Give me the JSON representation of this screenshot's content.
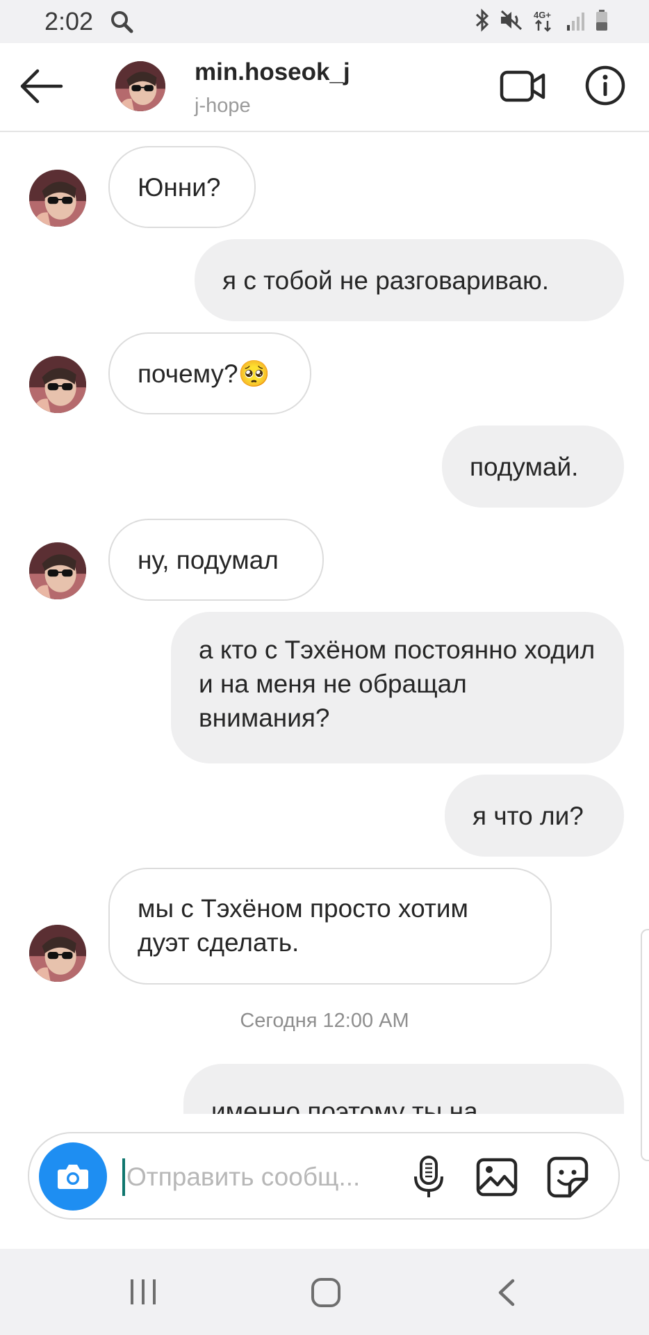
{
  "status_bar": {
    "time": "2:02",
    "network": "4G+",
    "icons": [
      "search-icon",
      "bluetooth-icon",
      "mute-icon",
      "network-4g-icon",
      "signal-icon",
      "battery-icon"
    ]
  },
  "header": {
    "username": "min.hoseok_j",
    "subtitle": "j-hope",
    "icons": [
      "back-arrow-icon",
      "video-call-icon",
      "info-icon"
    ]
  },
  "messages": [
    {
      "side": "in",
      "text": "Юнни?"
    },
    {
      "side": "out",
      "text": "я с тобой не разговариваю."
    },
    {
      "side": "in",
      "text": "почему?🥺"
    },
    {
      "side": "out",
      "text": "подумай."
    },
    {
      "side": "in",
      "text": "ну, подумал"
    },
    {
      "side": "out",
      "text": "а кто с Тэхёном постоянно ходил и на меня не обращал внимания?"
    },
    {
      "side": "out",
      "text": "я что ли?"
    },
    {
      "side": "in",
      "text": "мы с Тэхёном просто хотим дуэт сделать."
    },
    {
      "side": "out",
      "text": "именно поэтому ты на"
    }
  ],
  "timestamp": "Сегодня 12:00 AM",
  "composer": {
    "placeholder": "Отправить сообщ...",
    "icons": [
      "camera-icon",
      "microphone-icon",
      "gallery-icon",
      "sticker-icon"
    ]
  },
  "nav": {
    "icons": [
      "recent-apps-icon",
      "home-icon",
      "back-icon"
    ]
  },
  "colors": {
    "accent_blue": "#1e8ef2",
    "bubble_out": "#efeff0",
    "caret": "#0f766e"
  }
}
